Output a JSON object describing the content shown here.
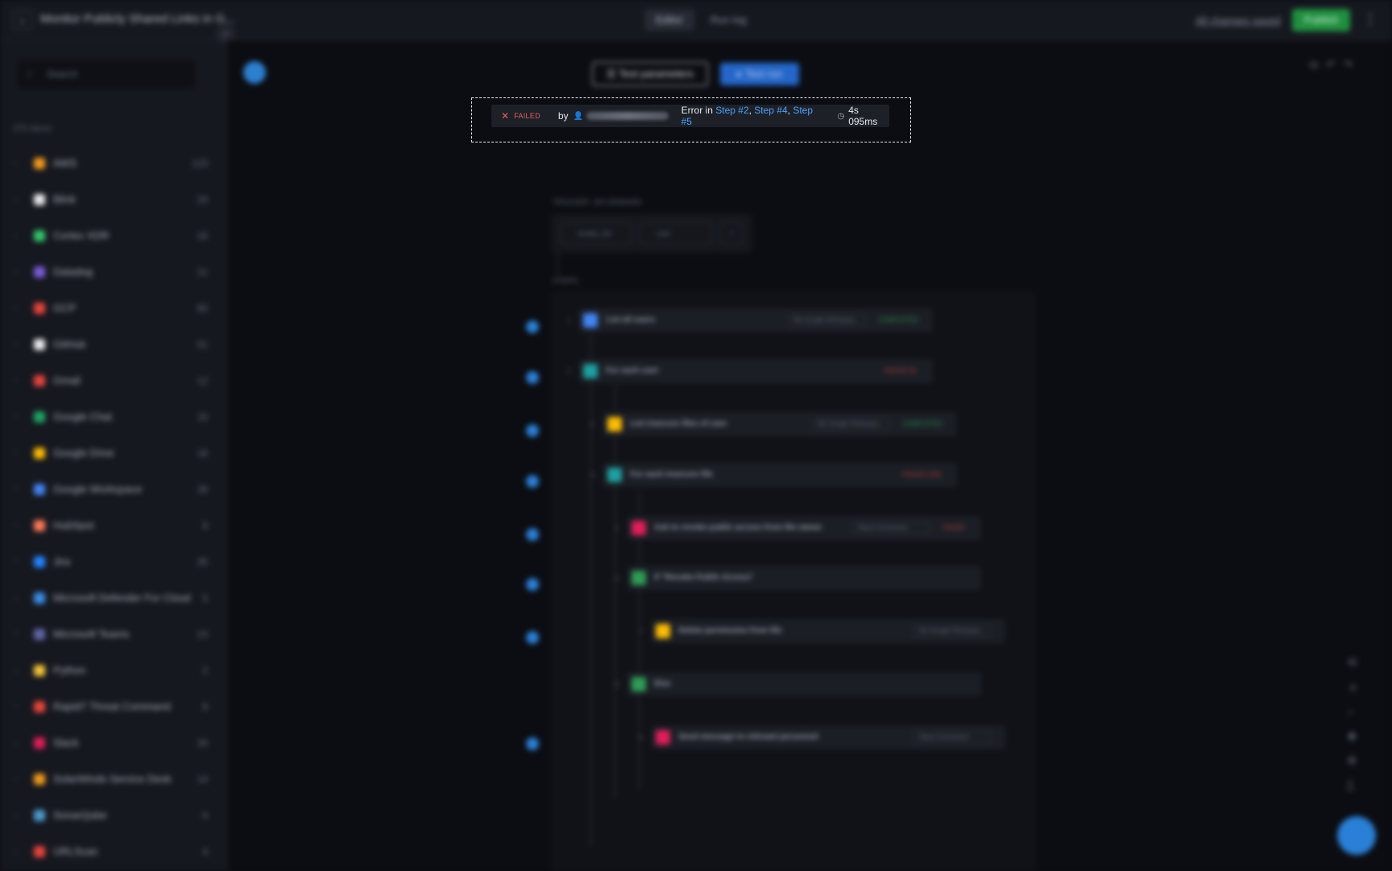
{
  "header": {
    "back_icon": "chevron-left-icon",
    "title": "Monitor Publicly Shared Links in G...",
    "tabs": [
      {
        "label": "Editor"
      },
      {
        "label": "Run log"
      }
    ],
    "save_status": "All changes saved",
    "publish_label": "Publish",
    "menu_icon": "kebab-icon"
  },
  "sidebar": {
    "search_placeholder": "Search",
    "item_count": "375 Items",
    "integrations": [
      {
        "label": "AWS",
        "count": "123",
        "color": "#f29b1d"
      },
      {
        "label": "Blink",
        "count": "24",
        "color": "#e6e8ec"
      },
      {
        "label": "Cortex XDR",
        "count": "16",
        "color": "#35c46a"
      },
      {
        "label": "Datadog",
        "count": "21",
        "color": "#7b5cd6"
      },
      {
        "label": "GCP",
        "count": "60",
        "color": "#e8453c"
      },
      {
        "label": "GitHub",
        "count": "51",
        "color": "#e6e8ec"
      },
      {
        "label": "Gmail",
        "count": "12",
        "color": "#e8453c"
      },
      {
        "label": "Google Chat",
        "count": "15",
        "color": "#1fa463"
      },
      {
        "label": "Google Drive",
        "count": "16",
        "color": "#fbbc04"
      },
      {
        "label": "Google Workspace",
        "count": "26",
        "color": "#4285f4"
      },
      {
        "label": "HubSpot",
        "count": "8",
        "color": "#ff7a59"
      },
      {
        "label": "Jira",
        "count": "35",
        "color": "#2684ff"
      },
      {
        "label": "Microsoft Defender For Cloud",
        "count": "5",
        "color": "#3b8ee8"
      },
      {
        "label": "Microsoft Teams",
        "count": "23",
        "color": "#6264a7"
      },
      {
        "label": "Python",
        "count": "2",
        "color": "#f7c53a"
      },
      {
        "label": "Rapid7 Threat Command",
        "count": "8",
        "color": "#e8453c"
      },
      {
        "label": "Slack",
        "count": "26",
        "color": "#e01e5a"
      },
      {
        "label": "SolarWinds Service Desk",
        "count": "14",
        "color": "#f29b1d"
      },
      {
        "label": "SonarQube",
        "count": "6",
        "color": "#4e9bcd"
      },
      {
        "label": "URLScan",
        "count": "4",
        "color": "#e8453c"
      }
    ]
  },
  "toolbar": {
    "test_parameters_label": "Test parameters",
    "test_run_label": "Test run"
  },
  "run_banner": {
    "status": "FAILED",
    "by_label": "by",
    "error_prefix": "Error in",
    "error_steps": [
      "Step #2",
      "Step #4",
      "Step #5"
    ],
    "duration": "4s 095ms"
  },
  "flow": {
    "trigger_label": "TRIGGER: ON-DEMAND",
    "params": [
      "emails_list",
      "user"
    ],
    "steps_label": "STEPS",
    "steps": [
      {
        "label": "List all users",
        "connection": "My Google Workspac...",
        "status": "COMPLETED",
        "status_color": "#2f9c56",
        "icon_color": "#4285f4"
      },
      {
        "label": "For each user",
        "connection": "",
        "status": "FAILED (2)",
        "status_color": "#c2453f",
        "icon_color": "#1ea0a0"
      },
      {
        "label": "List insecure files of user",
        "connection": "My Google Workspac...",
        "status": "COMPLETED",
        "status_color": "#2f9c56",
        "icon_color": "#fbbc04"
      },
      {
        "label": "For each insecure file",
        "connection": "",
        "status": "FAILED (100)",
        "status_color": "#c2453f",
        "icon_color": "#1ea0a0"
      },
      {
        "label": "Ask to revoke public access from file owner",
        "connection": "Slack Connection",
        "status": "FAILED",
        "status_color": "#c2453f",
        "icon_color": "#e01e5a"
      },
      {
        "label": "If \"Revoke Public Access\"",
        "connection": "",
        "status": "",
        "status_color": "#2f9c56",
        "icon_color": "#2f9c56"
      },
      {
        "label": "Delete permission from file",
        "connection": "My Google Workspac...",
        "status": "",
        "status_color": "#2f9c56",
        "icon_color": "#fbbc04"
      },
      {
        "label": "Else",
        "connection": "",
        "status": "",
        "status_color": "#2f9c56",
        "icon_color": "#2f9c56"
      },
      {
        "label": "Send message to relevant personnel",
        "connection": "Slack Connection",
        "status": "",
        "status_color": "#2f9c56",
        "icon_color": "#e01e5a"
      }
    ]
  }
}
